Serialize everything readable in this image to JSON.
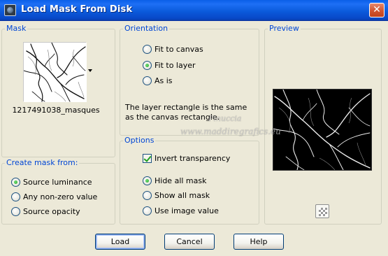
{
  "window": {
    "title": "Load Mask From Disk",
    "close_glyph": "✕",
    "icon": "app-icon"
  },
  "mask": {
    "title": "Mask",
    "filename": "1217491038_masques"
  },
  "create_mask_from": {
    "title": "Create mask from:",
    "options": [
      {
        "label": "Source luminance",
        "selected": true
      },
      {
        "label": "Any non-zero value",
        "selected": false
      },
      {
        "label": "Source opacity",
        "selected": false
      }
    ]
  },
  "orientation": {
    "title": "Orientation",
    "options": [
      {
        "label": "Fit to canvas",
        "selected": false
      },
      {
        "label": "Fit to layer",
        "selected": true
      },
      {
        "label": "As is",
        "selected": false
      }
    ],
    "note": "The layer rectangle is the same as the canvas rectangle."
  },
  "options": {
    "title": "Options",
    "invert_transparency": {
      "label": "Invert transparency",
      "checked": true
    },
    "radios": [
      {
        "label": "Hide all mask",
        "selected": true
      },
      {
        "label": "Show all mask",
        "selected": false
      },
      {
        "label": "Use image value",
        "selected": false
      }
    ]
  },
  "preview": {
    "title": "Preview",
    "watermark_line1": "Pinuccia",
    "watermark_line2": "www.maddiregrafics.eu"
  },
  "buttons": {
    "load": "Load",
    "cancel": "Cancel",
    "help": "Help"
  },
  "colors": {
    "titlebar": "#0A5FE8",
    "group_title": "#0046D5",
    "dialog_bg": "#ECE9D8",
    "radio_dot": "#21A121"
  }
}
